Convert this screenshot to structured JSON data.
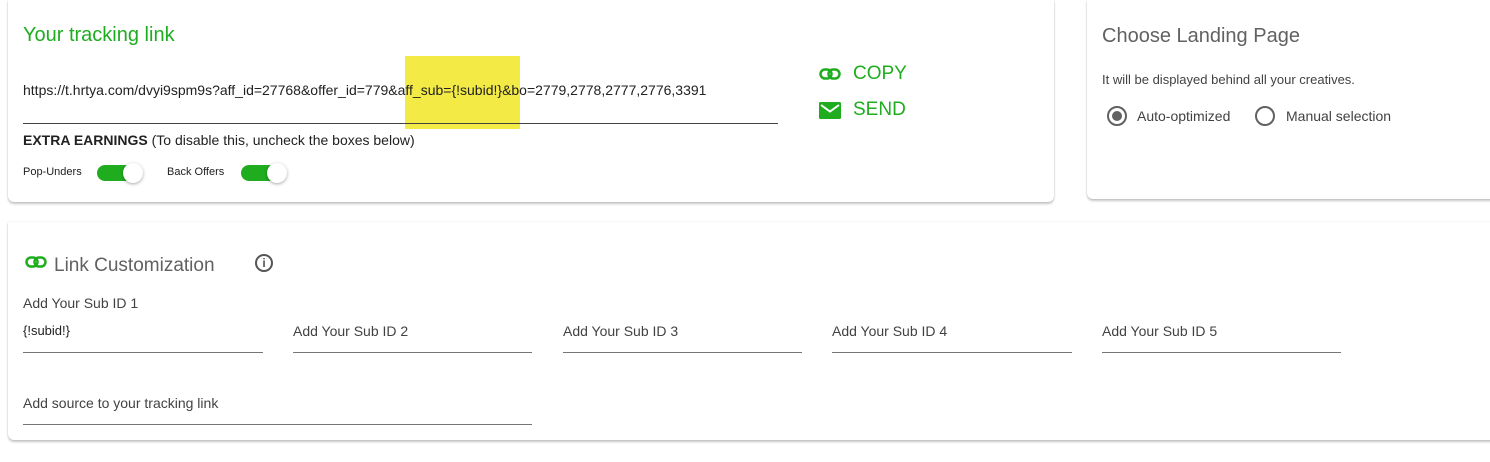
{
  "tracking": {
    "title": "Your tracking link",
    "url_pre": "https://t.hrtya.com/dvyi9spm9s?aff_id=27768&offer_id=779&",
    "url_mid": "aff_sub={!subid!}",
    "url_post": "&bo=2779,2778,2777,2776,3391",
    "copy_label": "COPY",
    "send_label": "SEND",
    "extra_bold": "EXTRA EARNINGS",
    "extra_rest": " (To disable this, uncheck the boxes below)",
    "toggles": [
      {
        "label": "Pop-Unders",
        "on": true
      },
      {
        "label": "Back Offers",
        "on": true
      }
    ]
  },
  "landing": {
    "title": "Choose Landing Page",
    "subtitle": "It will be displayed behind all your creatives.",
    "options": [
      {
        "label": "Auto-optimized",
        "checked": true
      },
      {
        "label": "Manual selection",
        "checked": false
      }
    ]
  },
  "customization": {
    "title": "Link Customization",
    "subids": [
      {
        "label": "Add Your Sub ID 1",
        "value": "{!subid!}"
      },
      {
        "label": "Add Your Sub ID 2",
        "value": ""
      },
      {
        "label": "Add Your Sub ID 3",
        "value": ""
      },
      {
        "label": "Add Your Sub ID 4",
        "value": ""
      },
      {
        "label": "Add Your Sub ID 5",
        "value": ""
      }
    ],
    "source_label": "Add source to your tracking link"
  },
  "colors": {
    "accent": "#1fad1f",
    "highlight": "#f3ea45"
  }
}
